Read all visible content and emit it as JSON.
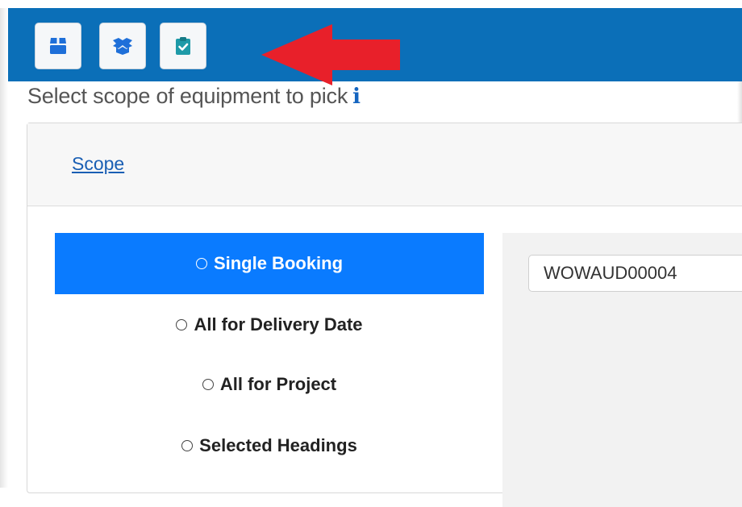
{
  "toolbar": {
    "buttons": [
      {
        "icon": "package-icon"
      },
      {
        "icon": "open-box-icon"
      },
      {
        "icon": "clipboard-check-icon"
      }
    ],
    "bg_color": "#0b6fb8",
    "annotation": "red-arrow-icon"
  },
  "heading": {
    "text": "Select scope of equipment to pick",
    "info_icon": "i"
  },
  "panel": {
    "tab_link": "Scope",
    "options": [
      {
        "label": "Single Booking",
        "selected": true
      },
      {
        "label": "All for Delivery Date",
        "selected": false
      },
      {
        "label": "All for Project",
        "selected": false
      },
      {
        "label": "Selected Headings",
        "selected": false
      }
    ],
    "booking_input": {
      "value": "WOWAUD00004"
    }
  },
  "colors": {
    "accent": "#0a7bff",
    "link": "#1a5fb4",
    "arrow": "#e8202a"
  }
}
